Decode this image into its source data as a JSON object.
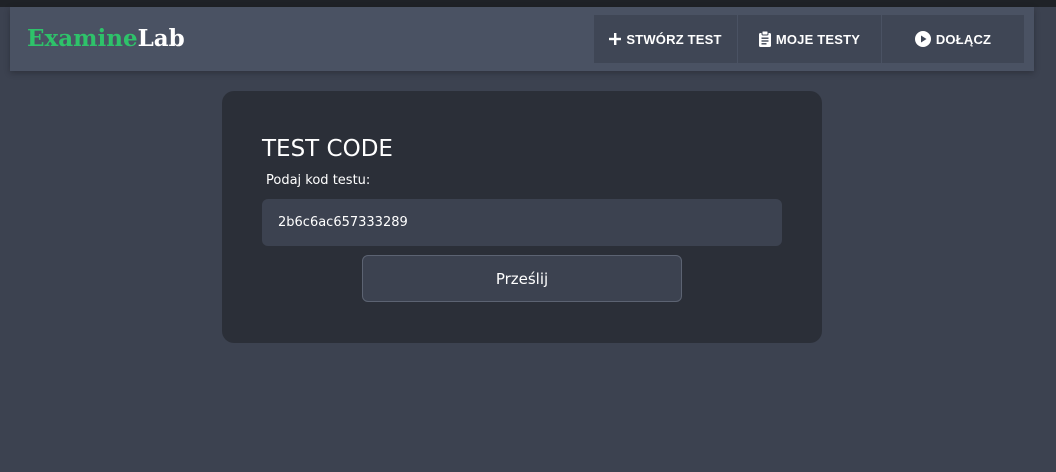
{
  "brand": {
    "part1": "Examine",
    "part2": "Lab",
    "part1_color": "#2ec26a",
    "part2_color": "#ffffff"
  },
  "nav": {
    "items": [
      {
        "label": "STWÓRZ TEST",
        "icon": "plus-icon"
      },
      {
        "label": "MOJE TESTY",
        "icon": "clipboard-icon"
      },
      {
        "label": "DOŁĄCZ",
        "icon": "play-circle-icon"
      }
    ]
  },
  "form": {
    "title": "TEST CODE",
    "label": "Podaj kod testu:",
    "input_value": "2b6c6ac657333289",
    "submit_label": "Prześlij"
  },
  "colors": {
    "page_background": "#3c4250",
    "navbar_background": "#4a5263",
    "nav_item_background": "#3f4655",
    "card_background": "#2b2f38",
    "accent_green": "#2ec26a"
  }
}
